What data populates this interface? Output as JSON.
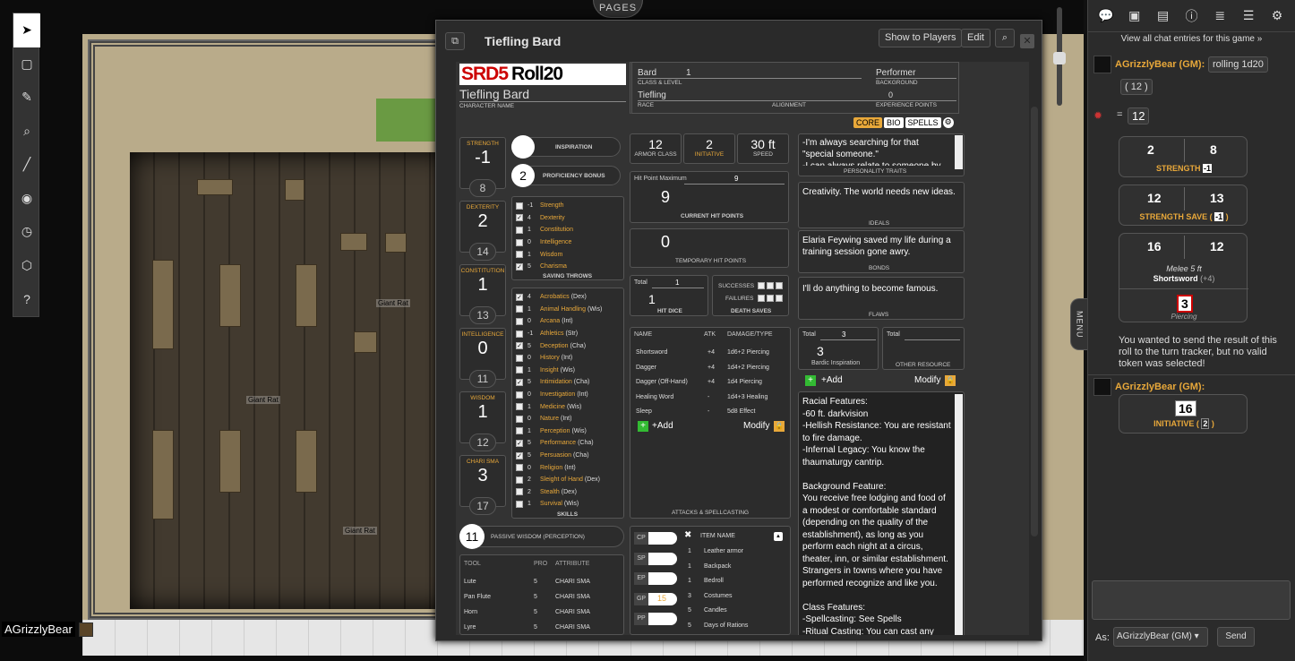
{
  "window": {
    "title": "Tiefling Bard",
    "pages_tab": "PAGES",
    "buttons": {
      "show": "Show to Players",
      "edit": "Edit"
    }
  },
  "player": {
    "name": "AGrizzlyBear"
  },
  "map": {
    "labels": [
      "Giant Rat",
      "Giant Rat",
      "Giant Rat"
    ]
  },
  "menu_tab": "MENU",
  "sheet": {
    "logo_text": "SRD5",
    "logo_roll": "Roll20",
    "char_name": "Tiefling Bard",
    "char_name_label": "CHARACTER NAME",
    "class_level": "Bard",
    "level": "1",
    "class_level_label": "CLASS & LEVEL",
    "background": "Performer",
    "background_label": "BACKGROUND",
    "race": "Tiefling",
    "race_label": "RACE",
    "alignment_label": "ALIGNMENT",
    "xp": "0",
    "xp_label": "EXPERIENCE POINTS",
    "tabs": [
      "CORE",
      "BIO",
      "SPELLS"
    ],
    "abilities": [
      {
        "name": "STRENGTH",
        "mod": "-1",
        "score": "8"
      },
      {
        "name": "DEXTERITY",
        "mod": "2",
        "score": "14"
      },
      {
        "name": "CONSTITUTION",
        "mod": "1",
        "score": "13"
      },
      {
        "name": "INTELLIGENCE",
        "mod": "0",
        "score": "11"
      },
      {
        "name": "WISDOM",
        "mod": "1",
        "score": "12"
      },
      {
        "name": "CHARI SMA",
        "mod": "3",
        "score": "17"
      }
    ],
    "inspiration": "INSPIRATION",
    "prof_bonus": "2",
    "prof_label": "PROFICIENCY BONUS",
    "saves": [
      {
        "v": "-1",
        "n": "Strength",
        "c": false
      },
      {
        "v": "4",
        "n": "Dexterity",
        "c": true
      },
      {
        "v": "1",
        "n": "Constitution",
        "c": false
      },
      {
        "v": "0",
        "n": "Intelligence",
        "c": false
      },
      {
        "v": "1",
        "n": "Wisdom",
        "c": false
      },
      {
        "v": "5",
        "n": "Charisma",
        "c": true
      }
    ],
    "saves_label": "SAVING THROWS",
    "skills": [
      {
        "v": "4",
        "n": "Acrobatics",
        "a": "(Dex)",
        "c": true
      },
      {
        "v": "1",
        "n": "Animal Handling",
        "a": "(Wis)",
        "c": false
      },
      {
        "v": "0",
        "n": "Arcana",
        "a": "(Int)",
        "c": false
      },
      {
        "v": "-1",
        "n": "Athletics",
        "a": "(Str)",
        "c": false
      },
      {
        "v": "5",
        "n": "Deception",
        "a": "(Cha)",
        "c": true
      },
      {
        "v": "0",
        "n": "History",
        "a": "(Int)",
        "c": false
      },
      {
        "v": "1",
        "n": "Insight",
        "a": "(Wis)",
        "c": false
      },
      {
        "v": "5",
        "n": "Intimidation",
        "a": "(Cha)",
        "c": true
      },
      {
        "v": "0",
        "n": "Investigation",
        "a": "(Int)",
        "c": false
      },
      {
        "v": "1",
        "n": "Medicine",
        "a": "(Wis)",
        "c": false
      },
      {
        "v": "0",
        "n": "Nature",
        "a": "(Int)",
        "c": false
      },
      {
        "v": "1",
        "n": "Perception",
        "a": "(Wis)",
        "c": false
      },
      {
        "v": "5",
        "n": "Performance",
        "a": "(Cha)",
        "c": true
      },
      {
        "v": "5",
        "n": "Persuasion",
        "a": "(Cha)",
        "c": true
      },
      {
        "v": "0",
        "n": "Religion",
        "a": "(Int)",
        "c": false
      },
      {
        "v": "2",
        "n": "Sleight of Hand",
        "a": "(Dex)",
        "c": false
      },
      {
        "v": "2",
        "n": "Stealth",
        "a": "(Dex)",
        "c": false
      },
      {
        "v": "1",
        "n": "Survival",
        "a": "(Wis)",
        "c": false
      }
    ],
    "skills_label": "SKILLS",
    "passive": "11",
    "passive_label": "PASSIVE WISDOM (PERCEPTION)",
    "tools_headers": [
      "TOOL",
      "PRO",
      "ATTRIBUTE"
    ],
    "tools": [
      [
        "Lute",
        "5",
        "CHARI SMA"
      ],
      [
        "Pan Flute",
        "5",
        "CHARI SMA"
      ],
      [
        "Horn",
        "5",
        "CHARI SMA"
      ],
      [
        "Lyre",
        "5",
        "CHARI SMA"
      ]
    ],
    "ac": "12",
    "ac_label": "ARMOR CLASS",
    "init": "2",
    "init_label": "INITIATIVE",
    "speed": "30 ft",
    "speed_label": "SPEED",
    "hp_max_label": "Hit Point Maximum",
    "hp_max": "9",
    "hp_cur": "9",
    "hp_cur_label": "CURRENT HIT POINTS",
    "temp_hp": "0",
    "temp_label": "TEMPORARY HIT POINTS",
    "hd_total_label": "Total",
    "hd_total": "1",
    "hd": "1",
    "hd_label": "HIT DICE",
    "successes": "SUCCESSES",
    "failures": "FAILURES",
    "death_label": "DEATH SAVES",
    "attack_headers": [
      "NAME",
      "ATK",
      "DAMAGE/TYPE"
    ],
    "attacks": [
      [
        "Shortsword",
        "+4",
        "1d6+2 Piercing"
      ],
      [
        "Dagger",
        "+4",
        "1d4+2 Piercing"
      ],
      [
        "Dagger (Off-Hand)",
        "+4",
        "1d4 Piercing"
      ],
      [
        "Healing Word",
        "-",
        "1d4+3 Healing"
      ],
      [
        "Sleep",
        "-",
        "5d8 Effect"
      ]
    ],
    "add": "+Add",
    "modify": "Modify",
    "attacks_label": "ATTACKS & SPELLCASTING",
    "coins": [
      {
        "n": "CP",
        "v": ""
      },
      {
        "n": "SP",
        "v": ""
      },
      {
        "n": "EP",
        "v": ""
      },
      {
        "n": "GP",
        "v": "15"
      },
      {
        "n": "PP",
        "v": ""
      }
    ],
    "item_header": "ITEM NAME",
    "items": [
      [
        "1",
        "Leather armor"
      ],
      [
        "1",
        "Backpack"
      ],
      [
        "1",
        "Bedroll"
      ],
      [
        "3",
        "Costumes"
      ],
      [
        "5",
        "Candles"
      ],
      [
        "5",
        "Days of Rations"
      ]
    ],
    "traits": "-I'm always searching for that \"special someone.\"\n-I can always relate to someone by",
    "traits_label": "PERSONALITY TRAITS",
    "ideals": "Creativity. The world needs new ideas.",
    "ideals_label": "IDEALS",
    "bonds": "Elaria Feywing saved my life during a training session gone awry.",
    "bonds_label": "BONDS",
    "flaws": "I'll do anything to become famous.",
    "flaws_label": "FLAWS",
    "res_total_label": "Total",
    "res_total": "3",
    "res": "3",
    "res_name": "Bardic Inspiration",
    "res2_total_label": "Total",
    "other_res": "OTHER RESOURCE",
    "features": "Racial Features:\n-60 ft. darkvision\n-Hellish Resistance: You are resistant to fire damage.\n-Infernal Legacy: You know the thaumaturgy cantrip.\n\nBackground Feature:\nYou receive free lodging and food of a modest or comfortable standard (depending on the quality of the establishment), as long as you perform each night at a circus, theater, inn, or similar establishment. Strangers in towns where you have performed recognize and like you.\n\nClass Features:\n-Spellcasting: See Spells\n-Ritual Casting: You can cast any"
  },
  "chat": {
    "all_link": "View all chat entries for this game »",
    "m1_who": "AGrizzlyBear (GM):",
    "m1_cmd": "rolling 1d20",
    "m1_paren": "( 12 )",
    "m1_eq": "=",
    "m1_res": "12",
    "str_a": "2",
    "str_b": "8",
    "str_label": "STRENGTH",
    "str_mod": "-1",
    "save_a": "12",
    "save_b": "13",
    "save_label": "STRENGTH SAVE",
    "save_mod": "-1",
    "atk_a": "16",
    "atk_b": "12",
    "atk_range": "Melee 5 ft",
    "atk_name": "Shortsword",
    "atk_mod": "(+4)",
    "dmg": "3",
    "dmg_type": "Piercing",
    "notice": "You wanted to send the result of this roll to the turn tracker, but no valid token was selected!",
    "m2_who": "AGrizzlyBear (GM):",
    "init_val": "16",
    "init_label": "INITIATIVE",
    "init_mod": "2",
    "as_label": "As:",
    "as_value": "AGrizzlyBear (GM)",
    "send": "Send"
  }
}
